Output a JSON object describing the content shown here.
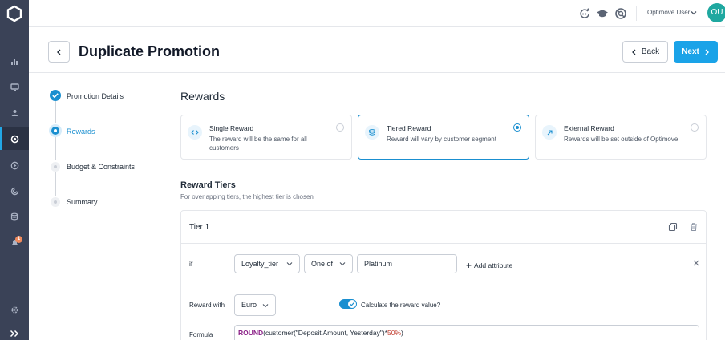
{
  "topbar": {
    "user_name": "Optimove User",
    "avatar_initials": "OU"
  },
  "header": {
    "title": "Duplicate Promotion",
    "back_label": "Back",
    "next_label": "Next"
  },
  "stepper": {
    "steps": [
      {
        "label": "Promotion Details",
        "state": "done"
      },
      {
        "label": "Rewards",
        "state": "active"
      },
      {
        "label": "Budget & Constraints",
        "state": "pending"
      },
      {
        "label": "Summary",
        "state": "pending"
      }
    ]
  },
  "rewards": {
    "title": "Rewards",
    "options": [
      {
        "title": "Single Reward",
        "desc": "The reward will be the same for all customers",
        "icon": "code-icon",
        "selected": false
      },
      {
        "title": "Tiered Reward",
        "desc": "Reward will vary by customer segment",
        "icon": "layers-icon",
        "selected": true
      },
      {
        "title": "External Reward",
        "desc": "Rewards will be set outside of Optimove",
        "icon": "external-arrow-icon",
        "selected": false
      }
    ]
  },
  "tiers": {
    "title": "Reward Tiers",
    "subtitle": "For overlapping tiers, the highest tier is chosen",
    "tier": {
      "name": "Tier 1",
      "if_label": "if",
      "attribute": "Loyalty_tier",
      "operator": "One of",
      "value": "Platinum",
      "add_attribute": "Add attribute",
      "reward_with_label": "Reward with",
      "currency": "Euro",
      "calculate_label": "Calculate the reward value?",
      "calculate_on": true,
      "formula_label": "Formula",
      "formula_fn": "ROUND",
      "formula_args": "(customer(\"Deposit Amount, Yesterday\")*",
      "formula_pct": "50%",
      "formula_end": ")"
    }
  },
  "colors": {
    "primary": "#1aa3e8",
    "nav_bg": "#3a4257",
    "avatar": "#1fa8a0"
  }
}
